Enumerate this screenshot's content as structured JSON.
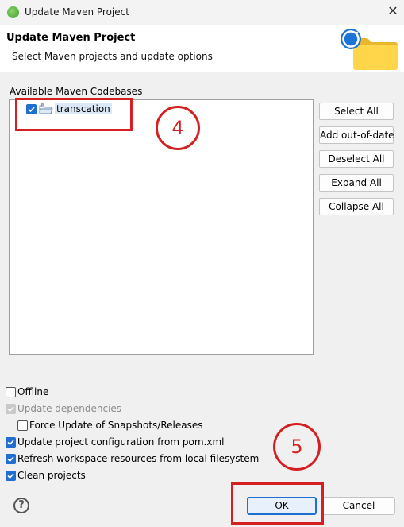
{
  "window": {
    "title": "Update Maven Project",
    "close_glyph": "✕"
  },
  "header": {
    "title": "Update Maven Project",
    "description": "Select Maven projects and update options",
    "icon": "update-folder-icon"
  },
  "codebases": {
    "label": "Available Maven Codebases",
    "items": [
      {
        "label": "transcation",
        "checked": true,
        "icon": "maven-project-folder-icon"
      }
    ]
  },
  "side_buttons": {
    "select_all": "Select All",
    "add_out_of_date": "Add out-of-date",
    "deselect_all": "Deselect All",
    "expand_all": "Expand All",
    "collapse_all": "Collapse All"
  },
  "options": {
    "offline": {
      "label": "Offline",
      "checked": false
    },
    "update_dependencies": {
      "label": "Update dependencies",
      "checked": true,
      "disabled": true
    },
    "force_update": {
      "label": "Force Update of Snapshots/Releases",
      "checked": false
    },
    "update_config": {
      "label": "Update project configuration from pom.xml",
      "checked": true
    },
    "refresh_workspace": {
      "label": "Refresh workspace resources from local filesystem",
      "checked": true
    },
    "clean_projects": {
      "label": "Clean projects",
      "checked": true
    }
  },
  "footer": {
    "help_glyph": "?",
    "ok_label": "OK",
    "cancel_label": "Cancel"
  },
  "annotations": {
    "step_a": "4",
    "step_b": "5",
    "color": "#d42020"
  }
}
